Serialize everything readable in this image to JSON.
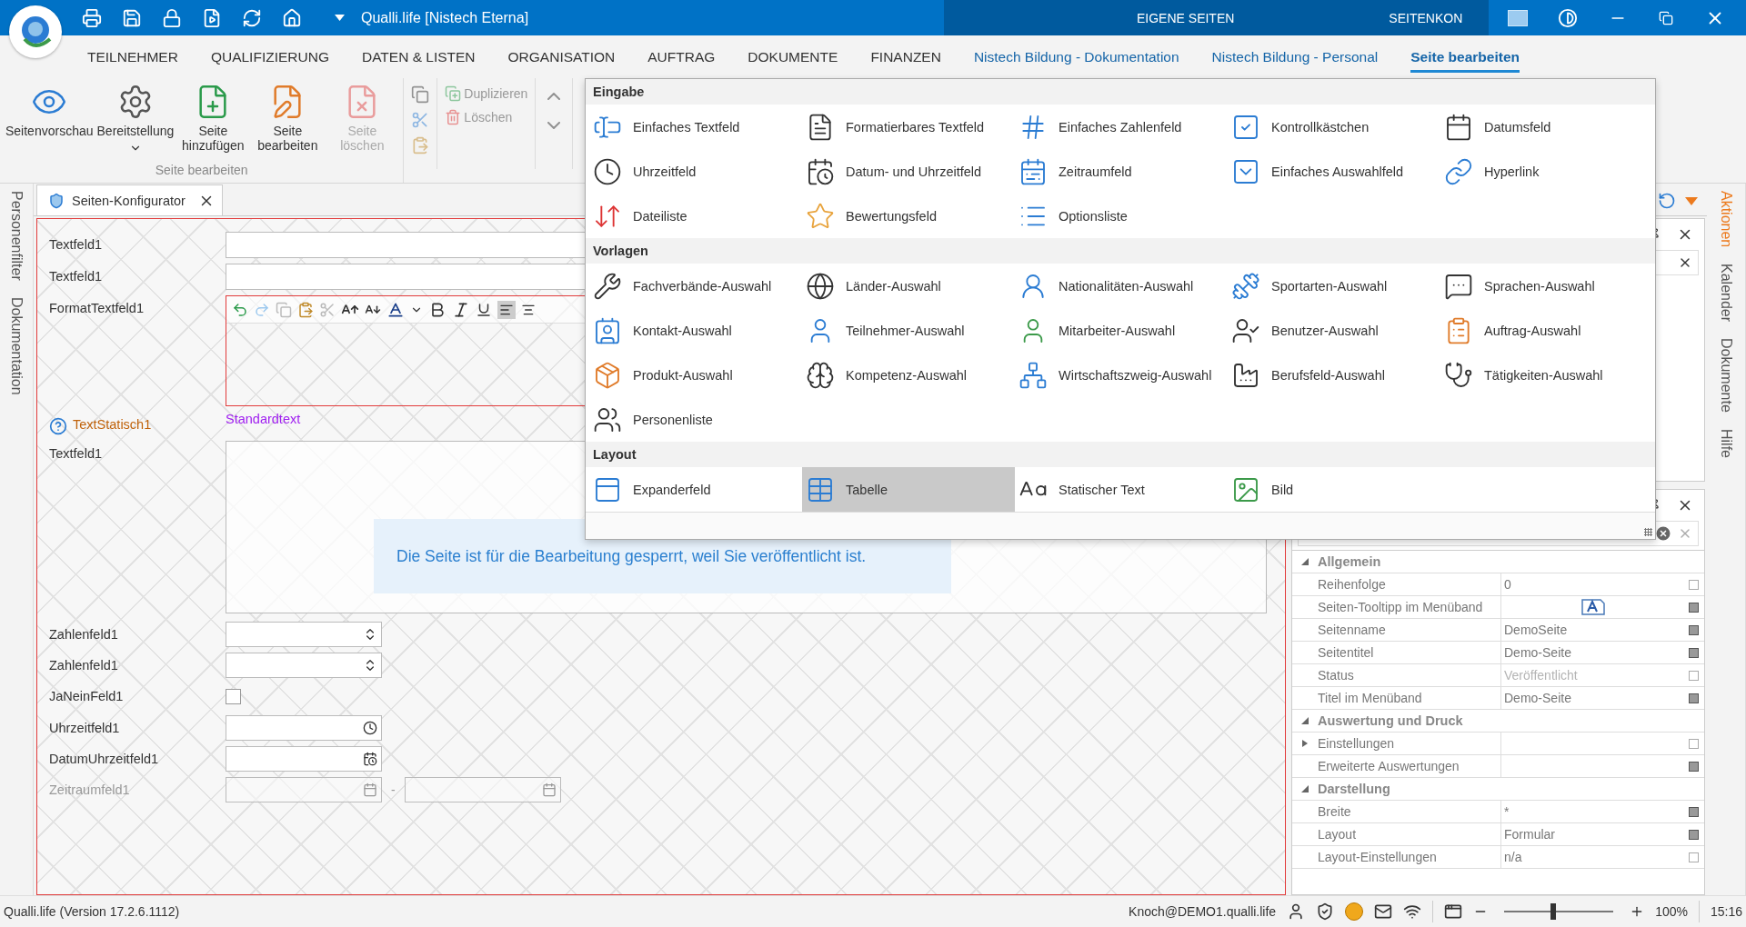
{
  "title_bar": {
    "title": "Qualli.life [Nistech Eterna]",
    "contexts": [
      "EIGENE SEITEN",
      "SEITENKON"
    ]
  },
  "menu_tabs": [
    {
      "label": "TEILNEHMER",
      "kind": "main",
      "selected": false
    },
    {
      "label": "QUALIFIZIERUNG",
      "kind": "main",
      "selected": false
    },
    {
      "label": "DATEN & LISTEN",
      "kind": "main",
      "selected": false
    },
    {
      "label": "ORGANISATION",
      "kind": "main",
      "selected": false
    },
    {
      "label": "AUFTRAG",
      "kind": "main",
      "selected": false
    },
    {
      "label": "DOKUMENTE",
      "kind": "main",
      "selected": false
    },
    {
      "label": "FINANZEN",
      "kind": "main",
      "selected": false
    },
    {
      "label": "Nistech Bildung - Dokumentation",
      "kind": "custom",
      "selected": false
    },
    {
      "label": "Nistech Bildung - Personal",
      "kind": "custom",
      "selected": false
    },
    {
      "label": "Seite bearbeiten",
      "kind": "custom",
      "selected": true
    }
  ],
  "ribbon": {
    "large_buttons": [
      {
        "label": "Seitenvorschau",
        "disabled": false,
        "dropdown": false
      },
      {
        "label": "Bereitstellung",
        "disabled": false,
        "dropdown": true
      },
      {
        "label": "Seite hinzufügen",
        "disabled": false,
        "dropdown": false
      },
      {
        "label": "Seite bearbeiten",
        "disabled": false,
        "dropdown": false
      },
      {
        "label": "Seite löschen",
        "disabled": true,
        "dropdown": false
      }
    ],
    "group_label": "Seite bearbeiten",
    "small_buttons": [
      {
        "label": "Duplizieren",
        "disabled": true
      },
      {
        "label": "Löschen",
        "disabled": true
      }
    ]
  },
  "left_tabs": [
    "Personenfilter",
    "Dokumentation"
  ],
  "right_tabs": [
    {
      "label": "Aktionen",
      "selected": true
    },
    {
      "label": "Kalender",
      "selected": false
    },
    {
      "label": "Dokumente",
      "selected": false
    },
    {
      "label": "Hilfe",
      "selected": false
    }
  ],
  "document_tab": {
    "title": "Seiten-Konfigurator"
  },
  "form": {
    "rows": [
      {
        "kind": "text",
        "label": "Textfeld1",
        "disabled": false
      },
      {
        "kind": "text",
        "label": "Textfeld1",
        "disabled": false
      },
      {
        "kind": "richtext",
        "label": "FormatTextfeld1",
        "disabled": false
      },
      {
        "kind": "static",
        "label": "TextStatisch1",
        "value": "Standardtext",
        "disabled": false
      },
      {
        "kind": "textarea",
        "label": "Textfeld1",
        "disabled": false
      },
      {
        "kind": "number",
        "label": "Zahlenfeld1",
        "disabled": false
      },
      {
        "kind": "number",
        "label": "Zahlenfeld1",
        "disabled": false
      },
      {
        "kind": "checkbox",
        "label": "JaNeinFeld1",
        "checked": false,
        "disabled": false
      },
      {
        "kind": "time",
        "label": "Uhrzeitfeld1",
        "disabled": false
      },
      {
        "kind": "datetime",
        "label": "DatumUhrzeitfeld1",
        "disabled": false
      },
      {
        "kind": "daterange",
        "label": "Zeitraumfeld1",
        "separator": "-",
        "disabled": true
      }
    ],
    "lock_message": "Die Seite ist für die Bearbeitung gesperrt, weil Sie veröffentlicht ist."
  },
  "properties": {
    "groups": [
      {
        "title": "Allgemein",
        "items": [
          {
            "kind": "value",
            "name": "Reihenfolge",
            "value": "0",
            "modified": false
          },
          {
            "kind": "icon",
            "name": "Seiten-Tooltipp im Menüband",
            "modified": true
          },
          {
            "kind": "value",
            "name": "Seitenname",
            "value": "DemoSeite",
            "modified": true
          },
          {
            "kind": "value",
            "name": "Seitentitel",
            "value": "Demo-Seite",
            "modified": true
          },
          {
            "kind": "value",
            "name": "Status",
            "value": "Veröffentlicht",
            "modified": false,
            "disabled": true
          },
          {
            "kind": "value",
            "name": "Titel im Menüband",
            "value": "Demo-Seite",
            "modified": true
          }
        ]
      },
      {
        "title": "Auswertung und Druck",
        "items": [
          {
            "kind": "nested",
            "name": "Einstellungen",
            "modified": false
          },
          {
            "kind": "value",
            "name": "Erweiterte Auswertungen",
            "modified": true
          }
        ]
      },
      {
        "title": "Darstellung",
        "items": [
          {
            "kind": "value",
            "name": "Breite",
            "value": "*",
            "modified": true
          },
          {
            "kind": "value",
            "name": "Layout",
            "value": "Formular",
            "modified": true
          },
          {
            "kind": "value",
            "name": "Layout-Einstellungen",
            "value": "n/a",
            "modified": false
          }
        ]
      }
    ]
  },
  "palette": {
    "sections": [
      {
        "title": "Eingabe",
        "items": [
          {
            "label": "Einfaches Textfeld",
            "selected": false
          },
          {
            "label": "Formatierbares Textfeld",
            "selected": false
          },
          {
            "label": "Einfaches Zahlenfeld",
            "selected": false
          },
          {
            "label": "Kontrollkästchen",
            "selected": false
          },
          {
            "label": "Datumsfeld",
            "selected": false
          },
          {
            "label": "Uhrzeitfeld",
            "selected": false
          },
          {
            "label": "Datum- und Uhrzeitfeld",
            "selected": false
          },
          {
            "label": "Zeitraumfeld",
            "selected": false
          },
          {
            "label": "Einfaches Auswahlfeld",
            "selected": false
          },
          {
            "label": "Hyperlink",
            "selected": false
          },
          {
            "label": "Dateiliste",
            "selected": false
          },
          {
            "label": "Bewertungsfeld",
            "selected": false
          },
          {
            "label": "Optionsliste",
            "selected": false
          }
        ]
      },
      {
        "title": "Vorlagen",
        "items": [
          {
            "label": "Fachverbände-Auswahl",
            "selected": false
          },
          {
            "label": "Länder-Auswahl",
            "selected": false
          },
          {
            "label": "Nationalitäten-Auswahl",
            "selected": false
          },
          {
            "label": "Sportarten-Auswahl",
            "selected": false
          },
          {
            "label": "Sprachen-Auswahl",
            "selected": false
          },
          {
            "label": "Kontakt-Auswahl",
            "selected": false
          },
          {
            "label": "Teilnehmer-Auswahl",
            "selected": false
          },
          {
            "label": "Mitarbeiter-Auswahl",
            "selected": false
          },
          {
            "label": "Benutzer-Auswahl",
            "selected": false
          },
          {
            "label": "Auftrag-Auswahl",
            "selected": false
          },
          {
            "label": "Produkt-Auswahl",
            "selected": false
          },
          {
            "label": "Kompetenz-Auswahl",
            "selected": false
          },
          {
            "label": "Wirtschaftszweig-Auswahl",
            "selected": false
          },
          {
            "label": "Berufsfeld-Auswahl",
            "selected": false
          },
          {
            "label": "Tätigkeiten-Auswahl",
            "selected": false
          },
          {
            "label": "Personenliste",
            "selected": false
          }
        ]
      },
      {
        "title": "Layout",
        "items": [
          {
            "label": "Expanderfeld",
            "selected": false
          },
          {
            "label": "Tabelle",
            "selected": true
          },
          {
            "label": "Statischer Text",
            "selected": false
          },
          {
            "label": "Bild",
            "selected": false
          }
        ]
      }
    ]
  },
  "status_bar": {
    "version": "Qualli.life (Version 17.2.6.1112)",
    "user": "Knoch@DEMO1.qualli.life",
    "zoom": {
      "level": 0.45,
      "reading": "100%"
    },
    "time": "15:16"
  }
}
